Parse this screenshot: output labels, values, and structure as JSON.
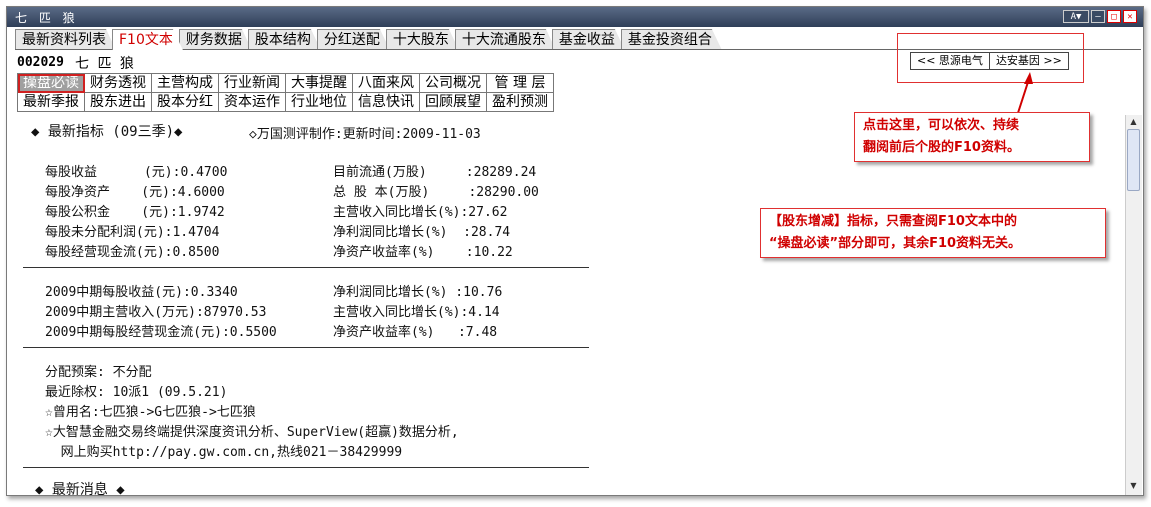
{
  "window": {
    "title": "七 匹 狼"
  },
  "titlebar_buttons": {
    "a": "A",
    "v": "▼",
    "min": "–",
    "max": "□",
    "close": "✕"
  },
  "tabs": [
    {
      "label": "最新资料列表"
    },
    {
      "label": "F10文本"
    },
    {
      "label": "财务数据"
    },
    {
      "label": "股本结构"
    },
    {
      "label": "分红送配"
    },
    {
      "label": "十大股东"
    },
    {
      "label": "十大流通股东"
    },
    {
      "label": "基金收益"
    },
    {
      "label": "基金投资组合"
    }
  ],
  "stock": {
    "code": "002029",
    "name": "七 匹 狼"
  },
  "nav": {
    "prev": "<< 思源电气",
    "next": "达安基因 >>"
  },
  "grid": {
    "row1": [
      "操盘必读",
      "财务透视",
      "主营构成",
      "行业新闻",
      "大事提醒",
      "八面来风",
      "公司概况",
      "管 理 层"
    ],
    "row2": [
      "最新季报",
      "股东进出",
      "股本分红",
      "资本运作",
      "行业地位",
      "信息快讯",
      "回顾展望",
      "盈利预测"
    ]
  },
  "content": {
    "header_title": "◆ 最新指标 (09三季)◆",
    "header_source": "◇万国测评制作:更新时间:2009-11-03",
    "left": [
      "每股收益      (元):0.4700",
      "每股净资产    (元):4.6000",
      "每股公积金    (元):1.9742",
      "每股未分配利润(元):1.4704",
      "每股经营现金流(元):0.8500"
    ],
    "right": [
      "目前流通(万股)     :28289.24",
      "总 股 本(万股)     :28290.00",
      "主营收入同比增长(%):27.62",
      "净利润同比增长(%)  :28.74",
      "净资产收益率(%)    :10.22"
    ],
    "mid_left": [
      "2009中期每股收益(元):0.3340",
      "2009中期主营收入(万元):87970.53",
      "2009中期每股经营现金流(元):0.5500"
    ],
    "mid_right": [
      "净利润同比增长(%) :10.76",
      "主营收入同比增长(%):4.14",
      "净资产收益率(%)   :7.48"
    ],
    "misc": [
      "分配预案: 不分配",
      "最近除权: 10派1 (09.5.21)",
      "☆曾用名:七匹狼->G七匹狼->七匹狼",
      "☆大智慧金融交易终端提供深度资讯分析、SuperView(超赢)数据分析,",
      "  网上购买http://pay.gw.com.cn,热线021－38429999"
    ],
    "news_title": "◆ 最新消息 ◆"
  },
  "callouts": {
    "c1_line1": "点击这里，可以依次、持续",
    "c1_line2": "翻阅前后个股的F10资料。",
    "c2_line1": "【股东增减】指标，只需查阅F10文本中的",
    "c2_line2": "“操盘必读”部分即可，其余F10资料无关。"
  },
  "colors": {
    "accent_red": "#d00000",
    "titlebar": "#3a4a63"
  }
}
